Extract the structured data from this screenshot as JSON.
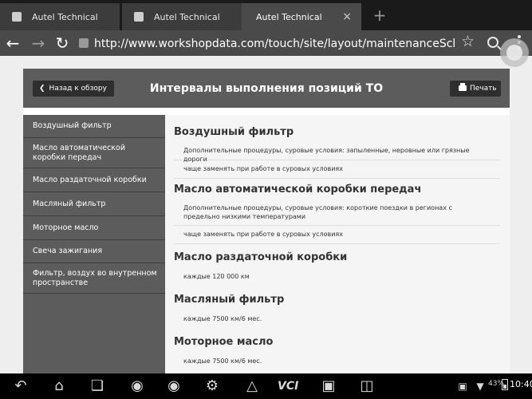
{
  "browser": {
    "tabs": [
      {
        "title": "Autel Technical"
      },
      {
        "title": "Autel Technical"
      },
      {
        "title": "Autel Technical",
        "close": "×"
      }
    ],
    "new_tab_symbol": "+",
    "url": "http://www.workshopdata.com/touch/site/layout/maintenanceSchedule?typeId"
  },
  "header": {
    "back_label": "Назад к обзору",
    "title": "Интервалы выполнения позиций ТО",
    "print_label": "Печать"
  },
  "sidebar": {
    "items": [
      {
        "label": "Воздушный фильтр"
      },
      {
        "label": "Масло автоматической коробки передач"
      },
      {
        "label": "Масло раздаточной коробки"
      },
      {
        "label": "Масляный фильтр"
      },
      {
        "label": "Моторное масло"
      },
      {
        "label": "Свеча зажигания"
      },
      {
        "label": "Фильтр, воздух во внутренном пространстве"
      }
    ]
  },
  "sections": [
    {
      "title": "Воздушный фильтр",
      "rows": [
        "Дополнительные процедуры, суровые условия: запыленные, неровные или грязные дороги",
        "чаще заменять при работе в суровых условиях"
      ]
    },
    {
      "title": "Масло автоматической коробки передач",
      "rows": [
        "Дополнительные процедуры, суровые условия: короткие поездки в регионах с предельно низкими температурами",
        "чаще заменять при работе в суровых условиях"
      ]
    },
    {
      "title": "Масло раздаточной коробки",
      "rows": [
        "каждые 120 000 км"
      ]
    },
    {
      "title": "Масляный фильтр",
      "rows": [
        "каждые 7500 км/6 мес."
      ]
    },
    {
      "title": "Моторное масло",
      "rows": [
        "каждые 7500 км/6 мес."
      ]
    }
  ],
  "system_bar": {
    "vci_label": "VCI",
    "battery_percent": "43%",
    "battery_level": 0.43,
    "time": "10:40"
  },
  "icons": [
    "back-arrow-icon",
    "home-icon",
    "recent-apps-icon",
    "chrome-icon",
    "camera-icon",
    "settings-icon",
    "maxisys-icon",
    "vci-icon",
    "car-icon",
    "data-manager-icon",
    "screenshot-icon",
    "wifi-icon",
    "battery-icon"
  ]
}
